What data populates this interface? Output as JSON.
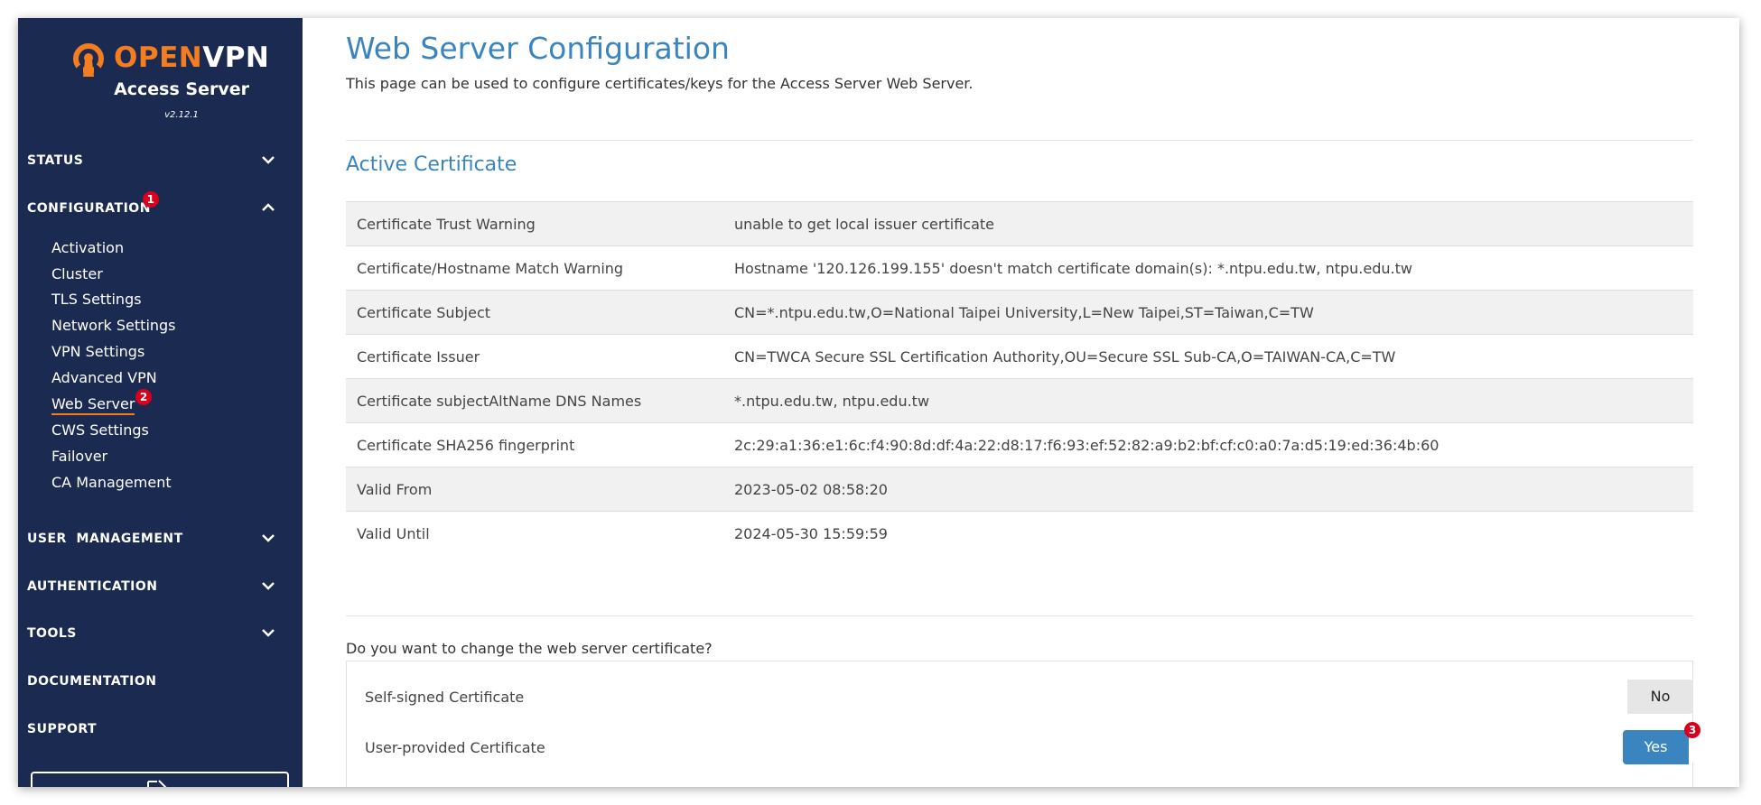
{
  "brand": {
    "name_open": "OPEN",
    "name_vpn": "VPN",
    "product": "Access Server",
    "version": "v2.12.1",
    "accent_color": "#f47d20",
    "sidebar_color": "#1b2a50"
  },
  "sidebar": {
    "sections": {
      "status": "STATUS",
      "configuration": "CONFIGURATION",
      "configuration_badge": "1",
      "user_management": "USER  MANAGEMENT",
      "authentication": "AUTHENTICATION",
      "tools": "TOOLS",
      "documentation": "DOCUMENTATION",
      "support": "SUPPORT"
    },
    "config_items": [
      "Activation",
      "Cluster",
      "TLS Settings",
      "Network Settings",
      "VPN Settings",
      "Advanced VPN",
      "Web Server",
      "CWS Settings",
      "Failover",
      "CA Management"
    ],
    "active_item": "Web Server",
    "active_badge": "2"
  },
  "main": {
    "title": "Web Server Configuration",
    "description": "This page can be used to configure certificates/keys for the Access Server Web Server.",
    "active_cert_title": "Active Certificate",
    "certificate": [
      {
        "key": "Certificate Trust Warning",
        "value": "unable to get local issuer certificate"
      },
      {
        "key": "Certificate/Hostname Match Warning",
        "value": "Hostname '120.126.199.155' doesn't match certificate domain(s): *.ntpu.edu.tw, ntpu.edu.tw"
      },
      {
        "key": "Certificate Subject",
        "value": "CN=*.ntpu.edu.tw,O=National Taipei University,L=New Taipei,ST=Taiwan,C=TW"
      },
      {
        "key": "Certificate Issuer",
        "value": "CN=TWCA Secure SSL Certification Authority,OU=Secure SSL Sub-CA,O=TAIWAN-CA,C=TW"
      },
      {
        "key": "Certificate subjectAltName DNS Names",
        "value": "*.ntpu.edu.tw, ntpu.edu.tw"
      },
      {
        "key": "Certificate SHA256 fingerprint",
        "value": "2c:29:a1:36:e1:6c:f4:90:8d:df:4a:22:d8:17:f6:93:ef:52:82:a9:b2:bf:cf:c0:a0:7a:d5:19:ed:36:4b:60"
      },
      {
        "key": "Valid From",
        "value": "2023-05-02 08:58:20"
      },
      {
        "key": "Valid Until",
        "value": "2024-05-30 15:59:59"
      }
    ],
    "change_question": "Do you want to change the web server certificate?",
    "options": {
      "self_signed_label": "Self-signed Certificate",
      "self_signed_value": "No",
      "user_provided_label": "User-provided Certificate",
      "user_provided_value": "Yes",
      "user_provided_badge": "3"
    },
    "link_color": "#3a85c0"
  }
}
